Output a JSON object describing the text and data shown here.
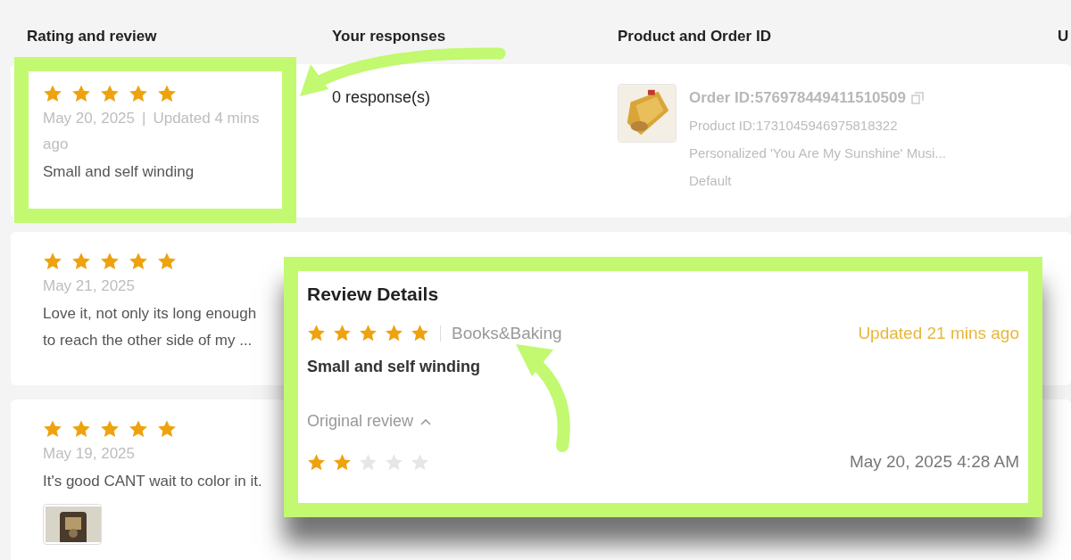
{
  "table": {
    "columns": [
      "Rating and review",
      "Your responses",
      "Product and Order ID",
      "U"
    ],
    "rows": [
      {
        "stars": 5,
        "date": "May 20, 2025",
        "separator": "|",
        "updated": "Updated 4 mins ago",
        "review": "Small and self winding",
        "responses": "0 response(s)",
        "product": {
          "order_id": "Order ID:576978449411510509",
          "product_id": "Product ID:1731045946975818322",
          "name": "Personalized 'You Are My Sunshine' Musi...",
          "variant": "Default"
        }
      },
      {
        "stars": 5,
        "date": "May 21, 2025",
        "review": "Love it, not only its long enough to reach the other side of my ..."
      },
      {
        "stars": 5,
        "date": "May 19, 2025",
        "review": "It's good CANT wait to color in it.",
        "has_photo": true
      }
    ]
  },
  "review_details": {
    "title": "Review Details",
    "stars": 5,
    "category": "Books&Baking",
    "updated": "Updated 21 mins ago",
    "review": "Small and self winding",
    "original": {
      "label": "Original review",
      "expanded": true,
      "stars": 2,
      "date": "May 20, 2025 4:28 AM"
    }
  }
}
